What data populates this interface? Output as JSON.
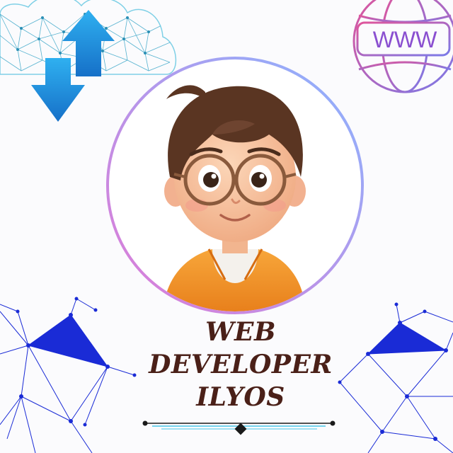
{
  "title": {
    "line1": "WEB",
    "line2": "DEVELOPER",
    "line3": "ILYOS"
  },
  "globe": {
    "label": "WWW"
  },
  "icons": {
    "cloud": "cloud-network-icon",
    "arrows": "upload-download-arrows-icon",
    "globe": "www-globe-icon",
    "avatar": "developer-avatar",
    "network_left": "network-graph-left",
    "network_right": "network-graph-right"
  },
  "colors": {
    "title": "#4a2018",
    "arrow": "#1a8fe0",
    "network": "#1a2bd6",
    "ring_start": "#e07ad6",
    "ring_end": "#8ab4ff"
  }
}
